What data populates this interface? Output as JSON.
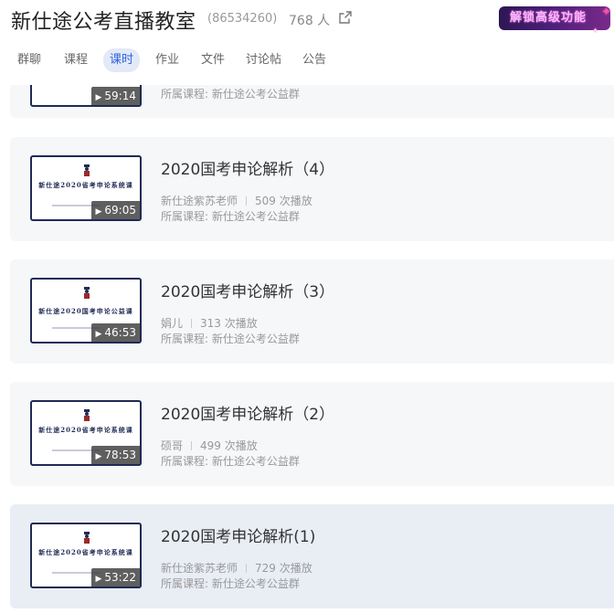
{
  "header": {
    "group_name": "新仕途公考直播教室",
    "group_id": "(86534260)",
    "member_count": "768 人",
    "unlock_label": "解锁高级功能"
  },
  "tabs": [
    {
      "label": "群聊",
      "active": false
    },
    {
      "label": "课程",
      "active": false
    },
    {
      "label": "课时",
      "active": true
    },
    {
      "label": "作业",
      "active": false
    },
    {
      "label": "文件",
      "active": false
    },
    {
      "label": "讨论帖",
      "active": false
    },
    {
      "label": "公告",
      "active": false
    }
  ],
  "lessons": [
    {
      "title": "",
      "teacher": "",
      "plays": "",
      "course": "所属课程: 新仕途公考公益群",
      "duration": "59:14",
      "thumb_title": ""
    },
    {
      "title": "2020国考申论解析（4）",
      "teacher": "新仕途紫苏老师",
      "plays": "509 次播放",
      "course": "所属课程: 新仕途公考公益群",
      "duration": "69:05",
      "thumb_title": "新仕途2020省考申论系统课"
    },
    {
      "title": "2020国考申论解析（3）",
      "teacher": "娟儿",
      "plays": "313 次播放",
      "course": "所属课程: 新仕途公考公益群",
      "duration": "46:53",
      "thumb_title": "新仕途2020国考申论公益课"
    },
    {
      "title": "2020国考申论解析（2）",
      "teacher": "硕哥",
      "plays": "499 次播放",
      "course": "所属课程: 新仕途公考公益群",
      "duration": "78:53",
      "thumb_title": "新仕途2020省考申论系统课"
    },
    {
      "title": "2020国考申论解析(1)",
      "teacher": "新仕途紫苏老师",
      "plays": "729 次播放",
      "course": "所属课程: 新仕途公考公益群",
      "duration": "53:22",
      "thumb_title": "新仕途2020省考申论系统课"
    }
  ],
  "colors": {
    "accent": "#2f64e0",
    "card_bg": "#f6f7f9",
    "card_hover_bg": "#e9edf4",
    "thumb_border": "#1f2a55"
  }
}
